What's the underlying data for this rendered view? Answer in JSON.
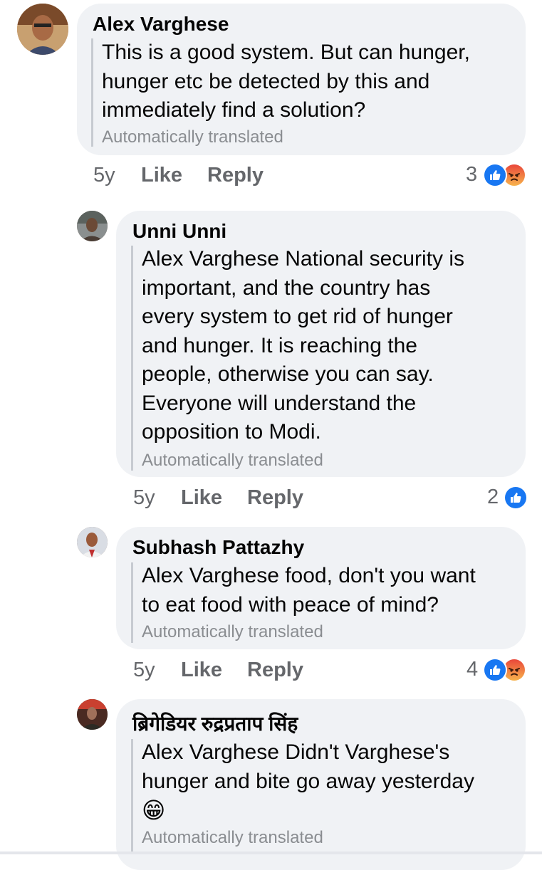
{
  "comments": [
    {
      "author": "Alex Varghese",
      "text_lines": [
        "This is a good system. But can hunger,",
        "hunger etc be detected by this and",
        "immediately find a solution?"
      ],
      "translated_note": "Automatically translated",
      "time": "5y",
      "like_label": "Like",
      "reply_label": "Reply",
      "reaction_count": "3",
      "reactions": [
        "like-icon",
        "angry-icon"
      ]
    },
    {
      "author": "Unni Unni",
      "text_lines": [
        "Alex Varghese National security is",
        "important, and the country has",
        "every system to get rid of hunger",
        "and hunger. It is reaching the",
        "people, otherwise you can say.",
        "Everyone will understand the",
        "opposition to Modi."
      ],
      "translated_note": "Automatically translated",
      "time": "5y",
      "like_label": "Like",
      "reply_label": "Reply",
      "reaction_count": "2",
      "reactions": [
        "like-icon"
      ]
    },
    {
      "author": "Subhash Pattazhy",
      "text_lines": [
        "Alex Varghese food, don't you want",
        "to eat food with peace of mind?"
      ],
      "translated_note": "Automatically translated",
      "time": "5y",
      "like_label": "Like",
      "reply_label": "Reply",
      "reaction_count": "4",
      "reactions": [
        "like-icon",
        "angry-icon"
      ]
    },
    {
      "author": "ब्रिगेडियर रुद्रप्रताप सिंह",
      "text_lines": [
        "Alex Varghese Didn't Varghese's",
        "hunger and bite go away yesterday"
      ],
      "emoji": "😁",
      "emoji_name": "grinning-face-icon",
      "translated_note": "Automatically translated"
    }
  ],
  "colors": {
    "bubble": "#f0f2f5",
    "like_blue": "#1877f2",
    "angry_orange": "#f7714c",
    "meta_gray": "#65676b",
    "translated_gray": "#8a8d91"
  }
}
